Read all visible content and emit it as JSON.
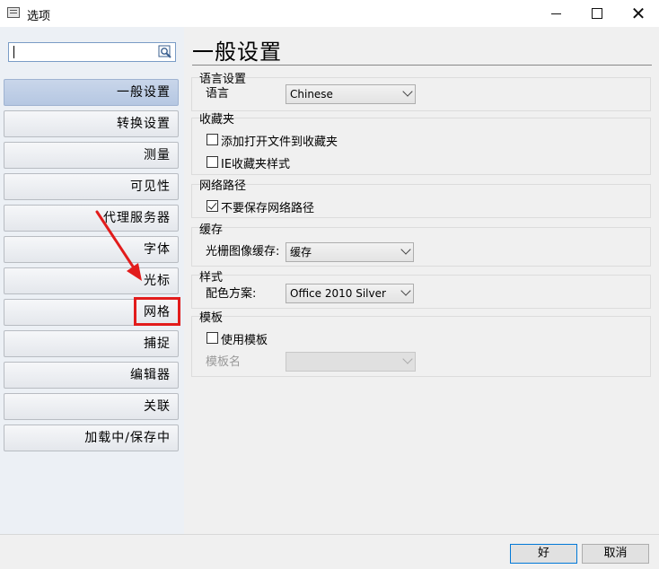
{
  "window": {
    "title": "选项"
  },
  "search": {
    "value": ""
  },
  "sidebar": {
    "items": [
      {
        "label": "一般设置"
      },
      {
        "label": "转换设置"
      },
      {
        "label": "测量"
      },
      {
        "label": "可见性"
      },
      {
        "label": "代理服务器"
      },
      {
        "label": "字体"
      },
      {
        "label": "光标"
      },
      {
        "label": "网格"
      },
      {
        "label": "捕捉"
      },
      {
        "label": "编辑器"
      },
      {
        "label": "关联"
      },
      {
        "label": "加载中/保存中"
      }
    ],
    "active_index": 0,
    "highlighted_item": "网格"
  },
  "main": {
    "title": "一般设置",
    "language": {
      "header": "语言设置",
      "label": "语言",
      "value": "Chinese"
    },
    "favorites": {
      "header": "收藏夹",
      "opt1": "添加打开文件到收藏夹",
      "opt1_checked": false,
      "opt2": "IE收藏夹样式",
      "opt2_checked": false
    },
    "network": {
      "header": "网络路径",
      "opt1": "不要保存网络路径",
      "opt1_checked": true
    },
    "cache": {
      "header": "缓存",
      "label": "光栅图像缓存:",
      "value": "缓存"
    },
    "style": {
      "header": "样式",
      "label": "配色方案:",
      "value": "Office 2010 Silver"
    },
    "template": {
      "header": "模板",
      "opt1": "使用模板",
      "opt1_checked": false,
      "label": "模板名",
      "value": ""
    }
  },
  "footer": {
    "ok_label": "好",
    "cancel_label": "取消"
  },
  "colors": {
    "annotation_red": "#e21c1c",
    "active_nav": "#b5c7e2"
  }
}
